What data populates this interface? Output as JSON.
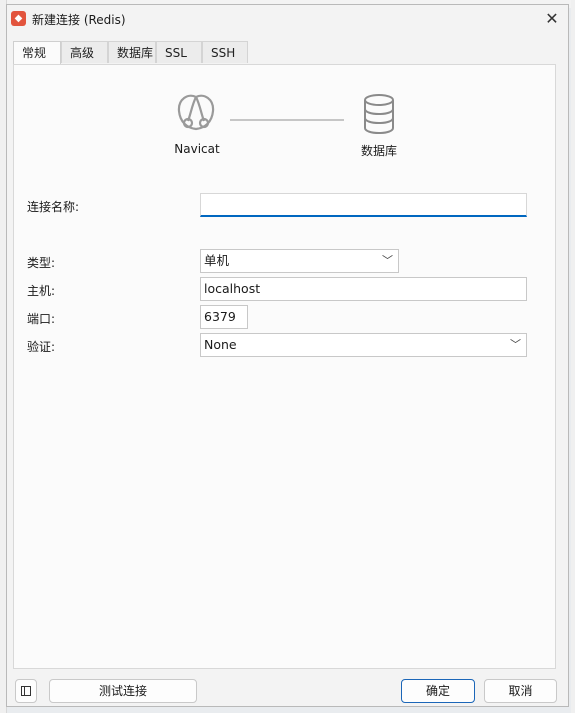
{
  "window": {
    "title": "新建连接 (Redis)",
    "close_glyph": "✕"
  },
  "tabs": [
    {
      "label": "常规"
    },
    {
      "label": "高级"
    },
    {
      "label": "数据库"
    },
    {
      "label": "SSL"
    },
    {
      "label": "SSH"
    }
  ],
  "diagram": {
    "left_label": "Navicat",
    "right_label": "数据库"
  },
  "form": {
    "connection_name": {
      "label": "连接名称:",
      "value": ""
    },
    "type": {
      "label": "类型:",
      "value": "单机"
    },
    "host": {
      "label": "主机:",
      "value": "localhost"
    },
    "port": {
      "label": "端口:",
      "value": "6379"
    },
    "auth": {
      "label": "验证:",
      "value": "None"
    }
  },
  "footer": {
    "test_label": "测试连接",
    "ok_label": "确定",
    "cancel_label": "取消"
  },
  "colors": {
    "accent": "#0067c0",
    "app_icon": "#e2543d"
  },
  "icons": [
    "redis-app-icon",
    "close-icon",
    "navicat-icon",
    "database-icon",
    "chevron-down-icon",
    "sidebar-toggle-icon"
  ]
}
